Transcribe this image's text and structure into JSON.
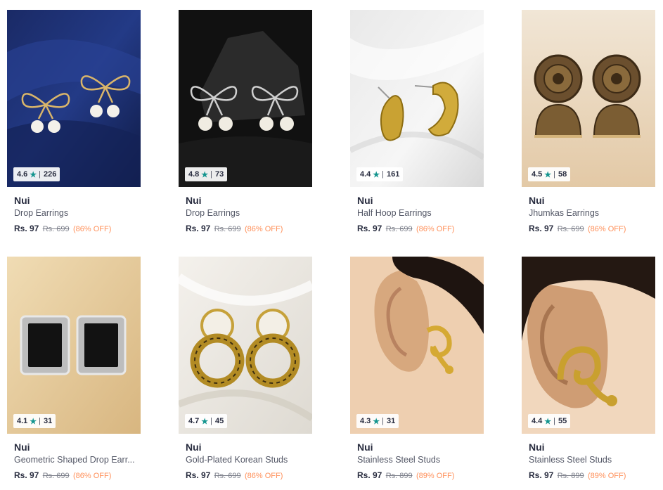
{
  "products": [
    {
      "brand": "Nui",
      "name": "Drop Earrings",
      "price": "Rs. 97",
      "mrp": "Rs. 699",
      "discount": "(86% OFF)",
      "rating": "4.6",
      "reviews": "226"
    },
    {
      "brand": "Nui",
      "name": "Drop Earrings",
      "price": "Rs. 97",
      "mrp": "Rs. 699",
      "discount": "(86% OFF)",
      "rating": "4.8",
      "reviews": "73"
    },
    {
      "brand": "Nui",
      "name": "Half Hoop Earrings",
      "price": "Rs. 97",
      "mrp": "Rs. 699",
      "discount": "(86% OFF)",
      "rating": "4.4",
      "reviews": "161"
    },
    {
      "brand": "Nui",
      "name": "Jhumkas Earrings",
      "price": "Rs. 97",
      "mrp": "Rs. 699",
      "discount": "(86% OFF)",
      "rating": "4.5",
      "reviews": "58"
    },
    {
      "brand": "Nui",
      "name": "Geometric Shaped Drop Earr...",
      "price": "Rs. 97",
      "mrp": "Rs. 699",
      "discount": "(86% OFF)",
      "rating": "4.1",
      "reviews": "31"
    },
    {
      "brand": "Nui",
      "name": "Gold-Plated Korean Studs",
      "price": "Rs. 97",
      "mrp": "Rs. 699",
      "discount": "(86% OFF)",
      "rating": "4.7",
      "reviews": "45"
    },
    {
      "brand": "Nui",
      "name": "Stainless Steel Studs",
      "price": "Rs. 97",
      "mrp": "Rs. 899",
      "discount": "(89% OFF)",
      "rating": "4.3",
      "reviews": "31"
    },
    {
      "brand": "Nui",
      "name": "Stainless Steel Studs",
      "price": "Rs. 97",
      "mrp": "Rs. 899",
      "discount": "(89% OFF)",
      "rating": "4.4",
      "reviews": "55"
    }
  ],
  "rating_star_icon": "star-icon",
  "colors": {
    "rating_star": "#14958f",
    "discount": "#ff905a",
    "brand_text": "#282c3f",
    "muted_text": "#7e818c"
  }
}
